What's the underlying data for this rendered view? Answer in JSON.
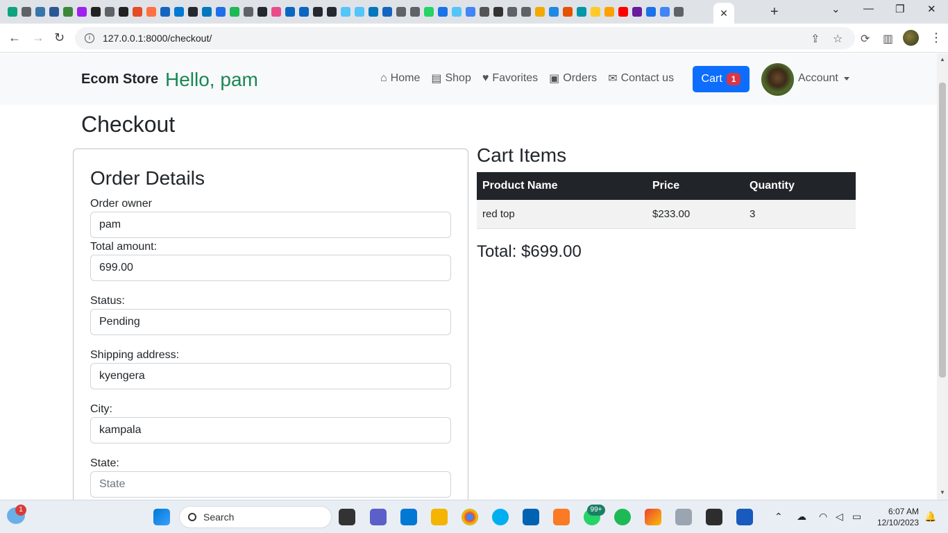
{
  "browser": {
    "url": "127.0.0.1:8000/checkout/",
    "tab_close": "✕",
    "new_tab": "+",
    "tab_colors": [
      "#10a37f",
      "#5f6368",
      "#3776ab",
      "#2b5797",
      "#3c873a",
      "#a020f0",
      "#222222",
      "#5f6368",
      "#222222",
      "#e44d26",
      "#ff7043",
      "#1565c0",
      "#0078d4",
      "#24292f",
      "#0277bd",
      "#1f6feb",
      "#1db954",
      "#5f6368",
      "#24292f",
      "#ea4c89",
      "#0a66c2",
      "#0a66c2",
      "#24292f",
      "#24292f",
      "#54c5f8",
      "#54c5f8",
      "#0277bd",
      "#1565c0",
      "#5f6368",
      "#5f6368",
      "#25d366",
      "#1a73e8",
      "#54c5f8",
      "#4285f4",
      "#555555",
      "#333333",
      "#5f6368",
      "#5f6368",
      "#f2a900",
      "#1e88e5",
      "#e65100",
      "#0097a7",
      "#ffca28",
      "#ffa000",
      "#ff0000",
      "#6a1b9a",
      "#1a73e8",
      "#4285f4",
      "#5f6368"
    ]
  },
  "navbar": {
    "brand": "Ecom Store",
    "greeting": "Hello, pam",
    "links": [
      {
        "icon": "home-icon",
        "glyph": "⌂",
        "label": "Home"
      },
      {
        "icon": "shop-icon",
        "glyph": "▤",
        "label": "Shop"
      },
      {
        "icon": "heart-icon",
        "glyph": "♥",
        "label": "Favorites"
      },
      {
        "icon": "bag-icon",
        "glyph": "▣",
        "label": "Orders"
      },
      {
        "icon": "envelope-icon",
        "glyph": "✉",
        "label": "Contact us"
      }
    ],
    "cart_label": "Cart",
    "cart_count": "1",
    "account_label": "Account"
  },
  "page": {
    "title": "Checkout"
  },
  "order": {
    "heading": "Order Details",
    "fields": [
      {
        "label": "Order owner",
        "value": "pam"
      },
      {
        "label": "Total amount:",
        "value": "699.00"
      },
      {
        "label": "Status:",
        "value": "Pending"
      },
      {
        "label": "Shipping address:",
        "value": "kyengera"
      },
      {
        "label": "City:",
        "value": "kampala"
      },
      {
        "label": "State:",
        "placeholder": "State"
      }
    ]
  },
  "cart": {
    "heading": "Cart Items",
    "columns": [
      "Product Name",
      "Price",
      "Quantity"
    ],
    "rows": [
      [
        "red top",
        "$233.00",
        "3"
      ]
    ],
    "total": "Total: $699.00"
  },
  "taskbar": {
    "search_label": "Search",
    "time": "6:07 AM",
    "date": "12/10/2023",
    "whatsapp_badge": "99+",
    "weather_badge": "1"
  }
}
